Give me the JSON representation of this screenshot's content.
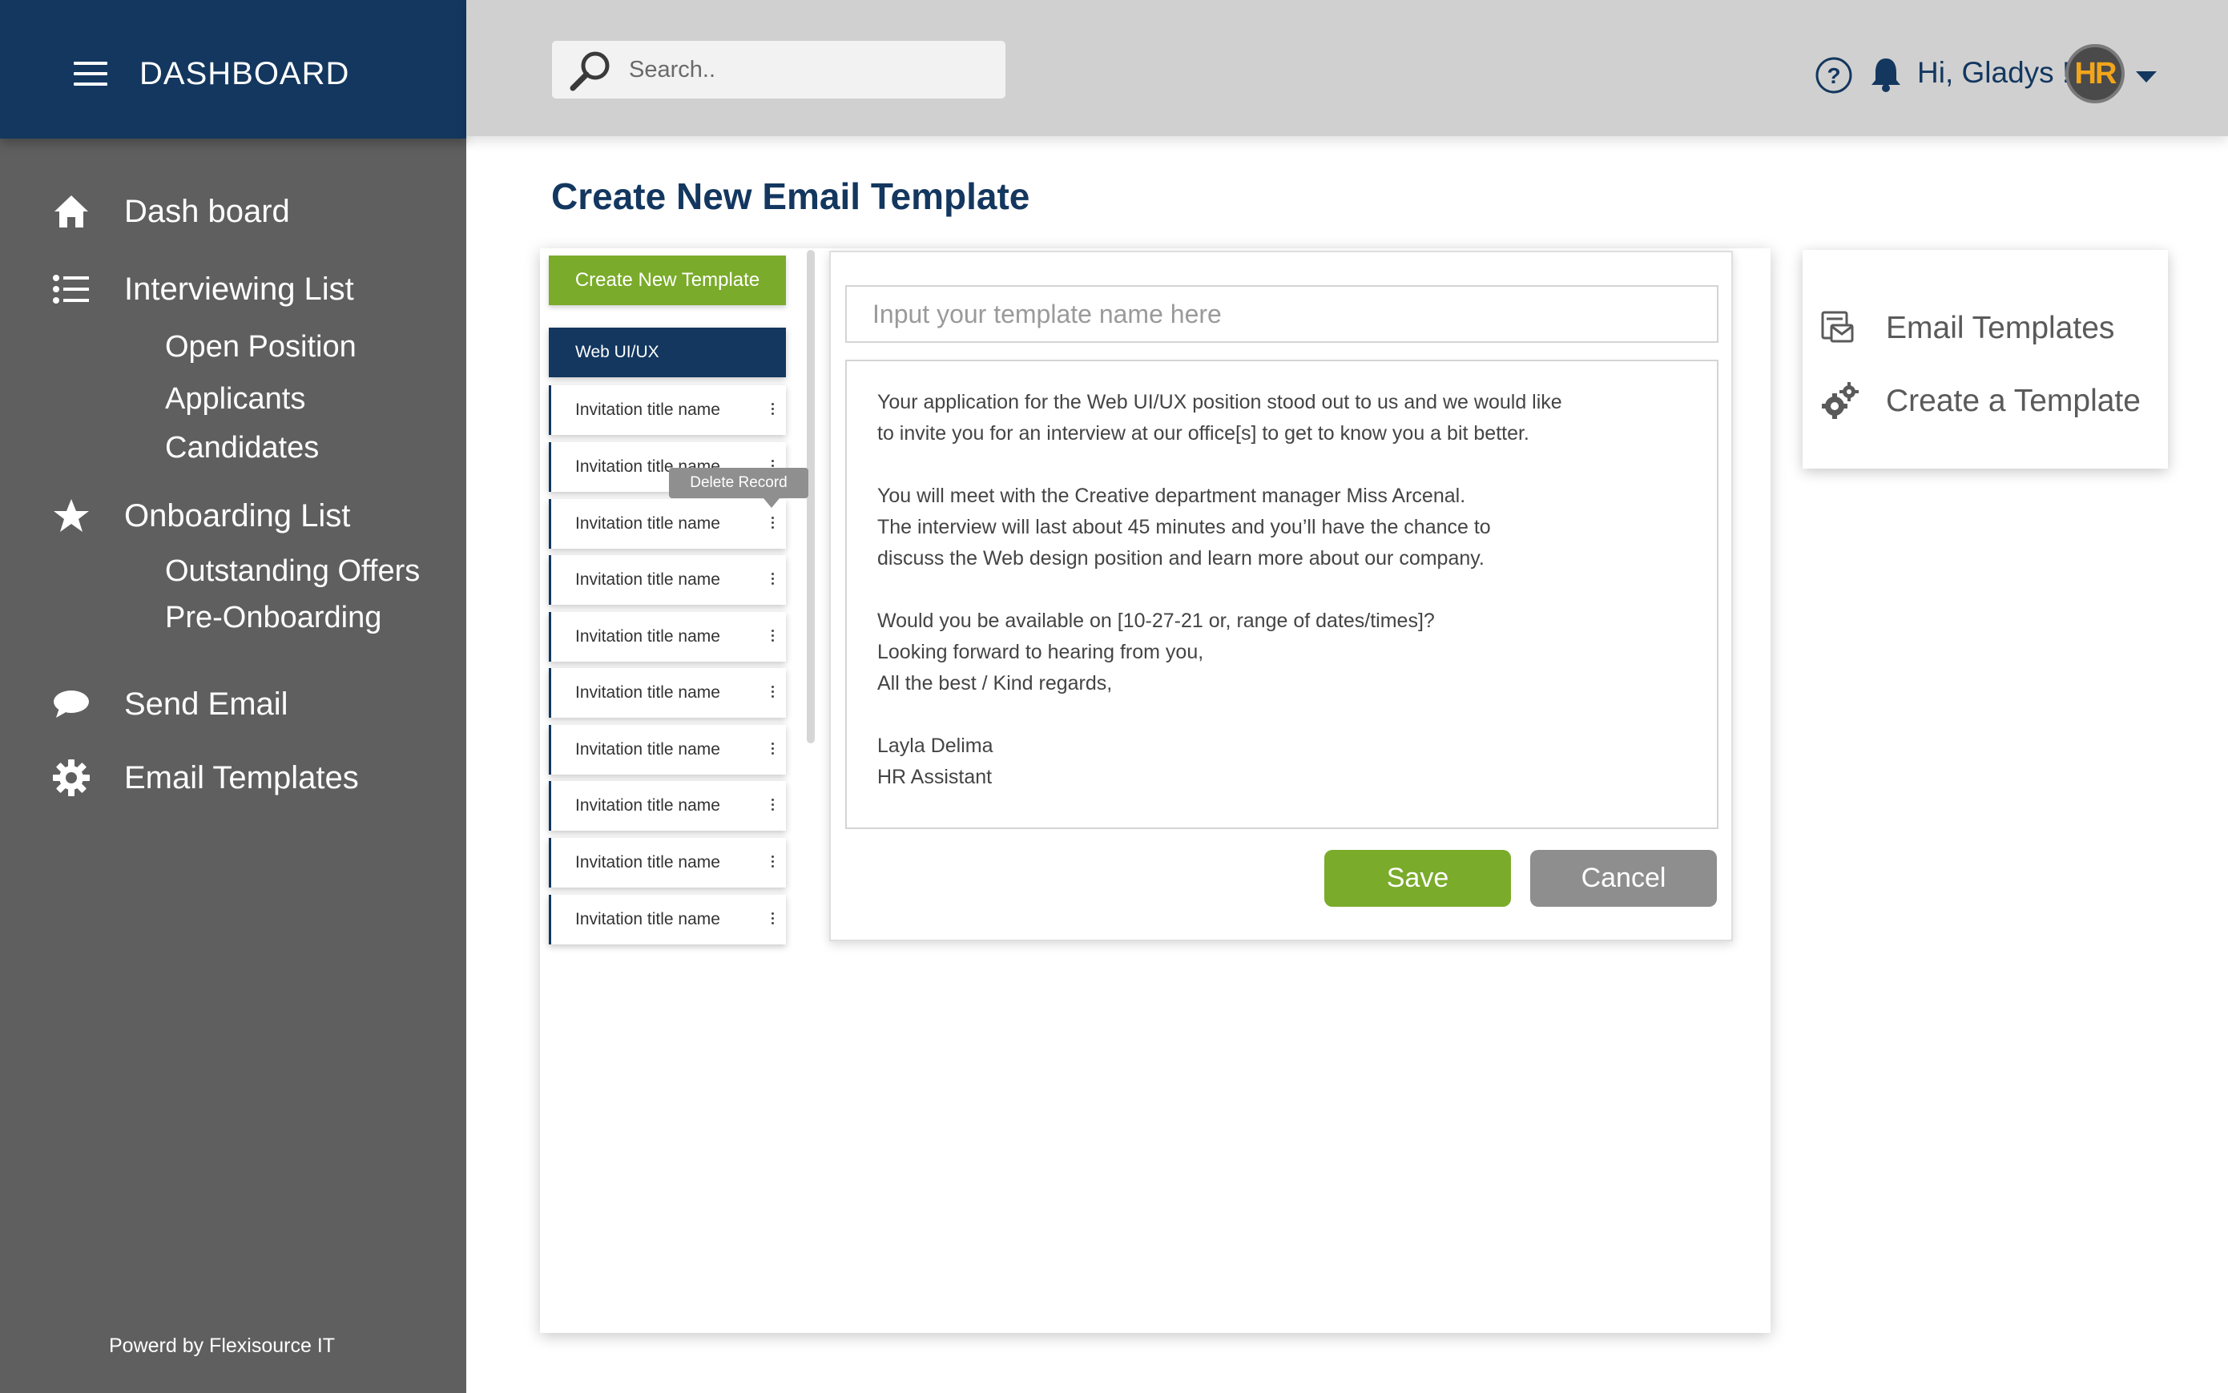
{
  "sidebar": {
    "title": "DASHBOARD",
    "items": [
      {
        "label": "Dash board",
        "icon": "home-icon"
      },
      {
        "label": "Interviewing List",
        "icon": "list-icon"
      },
      {
        "label": "Onboarding List",
        "icon": "star-icon"
      },
      {
        "label": "Send Email",
        "icon": "chat-bubble-icon"
      },
      {
        "label": "Email Templates",
        "icon": "gear-icon"
      }
    ],
    "interviewing_sub": [
      "Open Position",
      "Applicants",
      "Candidates"
    ],
    "onboarding_sub": [
      "Outstanding Offers",
      "Pre-Onboarding"
    ],
    "footer": "Powerd by Flexisource IT"
  },
  "topbar": {
    "search_placeholder": "Search..",
    "greeting": "Hi, Gladys !",
    "avatar_text": "HR"
  },
  "main": {
    "page_title": "Create New Email Template",
    "create_button": "Create New Template",
    "templates": [
      "Web UI/UX",
      "Invitation title name",
      "Invitation title name",
      "Invitation title name",
      "Invitation title name",
      "Invitation title name",
      "Invitation title name",
      "Invitation title name",
      "Invitation title name",
      "Invitation title name",
      "Invitation title name"
    ],
    "tooltip": "Delete Record"
  },
  "editor": {
    "name_placeholder": "Input your template name here",
    "body_lines": [
      "Your application for the Web UI/UX position stood out to us and we would like",
      "to invite you for an interview at our office[s] to get to know you a bit better.",
      "",
      "You will meet with the Creative department manager Miss Arcenal.",
      "The interview will last about 45 minutes and you’ll have the chance to",
      "discuss the Web design position and learn more about our company.",
      "",
      "Would you be available on [10-27-21   or, range of dates/times]?",
      "Looking forward to hearing from you,",
      "All the best / Kind regards,",
      "",
      "Layla Delima",
      "HR Assistant"
    ],
    "save": "Save",
    "cancel": "Cancel"
  },
  "right_panel": {
    "items": [
      {
        "label": "Email Templates",
        "icon": "email-template-icon"
      },
      {
        "label": "Create a Template",
        "icon": "gears-icon"
      }
    ]
  },
  "colors": {
    "navy": "#13375f",
    "sidebar": "#5f5f5f",
    "topbar": "#d0d0d0",
    "green": "#7aab2a",
    "gray_button": "#8e8e8e",
    "avatar_accent": "#f2a51b"
  }
}
